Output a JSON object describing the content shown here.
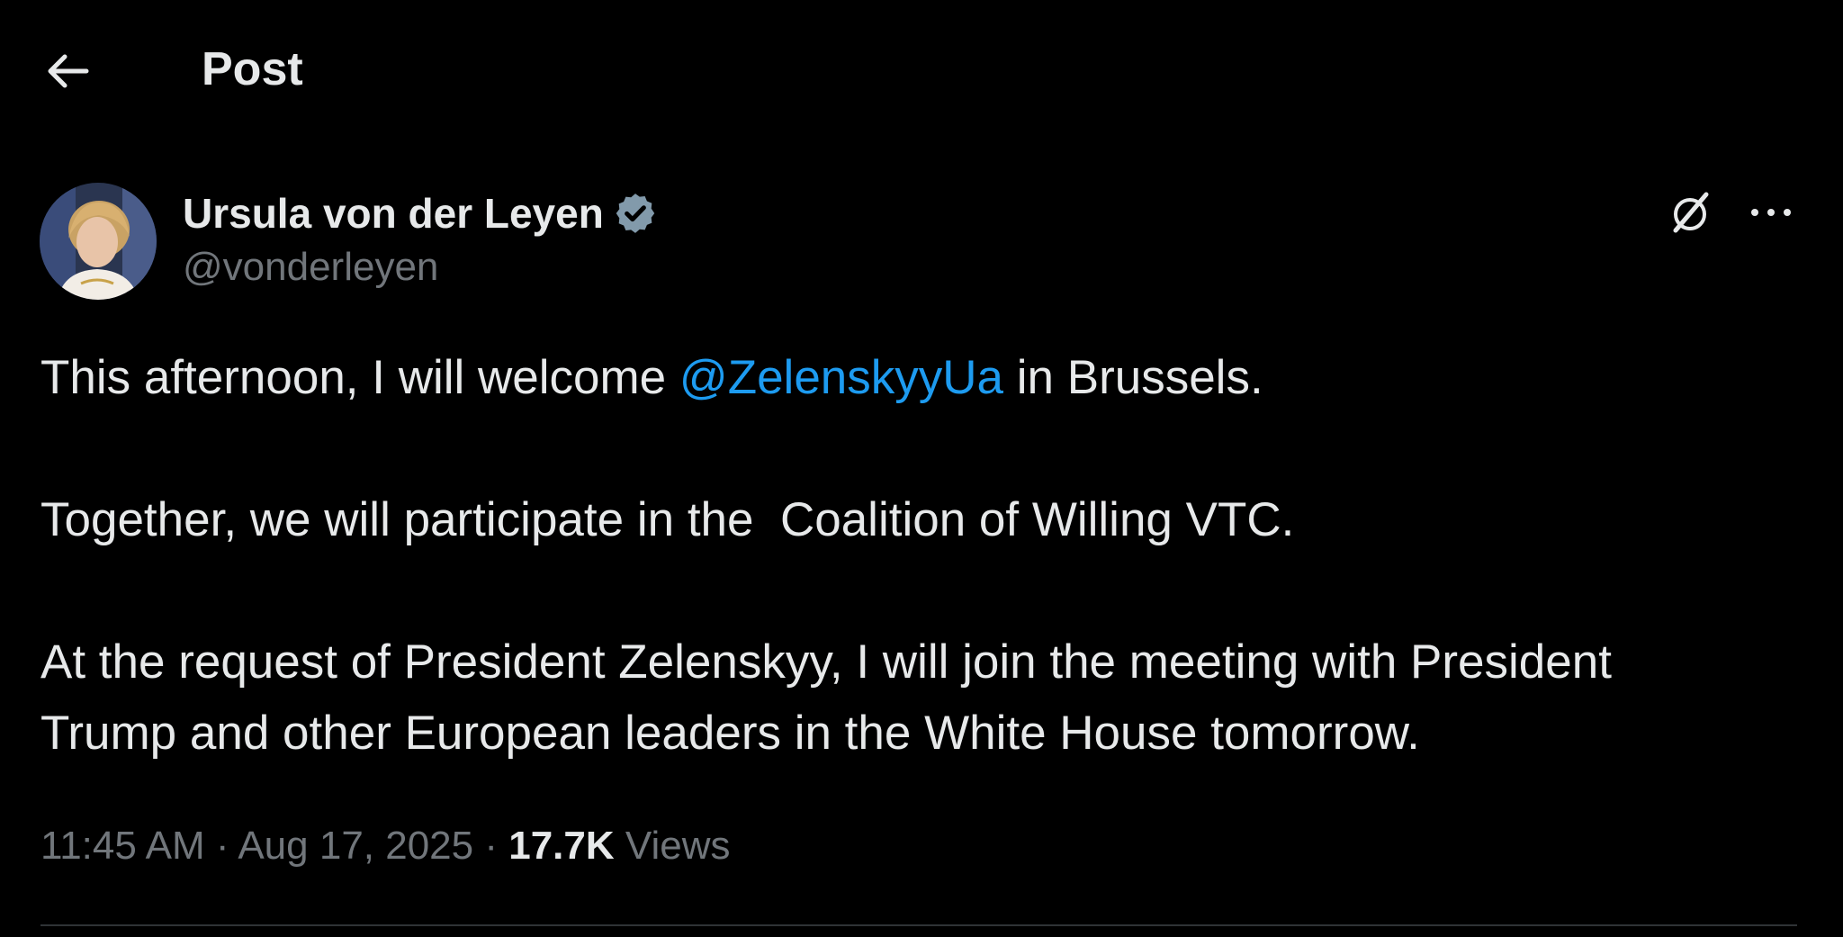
{
  "header": {
    "title": "Post",
    "back_icon": "arrow-left-icon"
  },
  "author": {
    "display_name": "Ursula von der Leyen",
    "handle": "@vonderleyen",
    "verified_icon": "verified-badge-icon",
    "verified_color": "#829aab"
  },
  "actions": {
    "grok_icon": "grok-icon",
    "more_icon": "more-horizontal-icon"
  },
  "tweet": {
    "line1_before": "This afternoon, I will welcome ",
    "line1_mention": "@ZelenskyyUa",
    "line1_after": " in Brussels.",
    "paragraph2": "Together, we will participate in the  Coalition of Willing VTC.",
    "paragraph3_line1": "At the request of President Zelenskyy, I will join the meeting with President",
    "paragraph3_line2": "Trump and other European leaders in the White House tomorrow."
  },
  "meta": {
    "time": "11:45 AM",
    "separator": " · ",
    "date": "Aug 17, 2025",
    "views_count": "17.7K",
    "views_label": "Views"
  },
  "colors": {
    "background": "#000000",
    "text_primary": "#e7e9ea",
    "text_secondary": "#71767b",
    "accent": "#1d9bf0"
  }
}
